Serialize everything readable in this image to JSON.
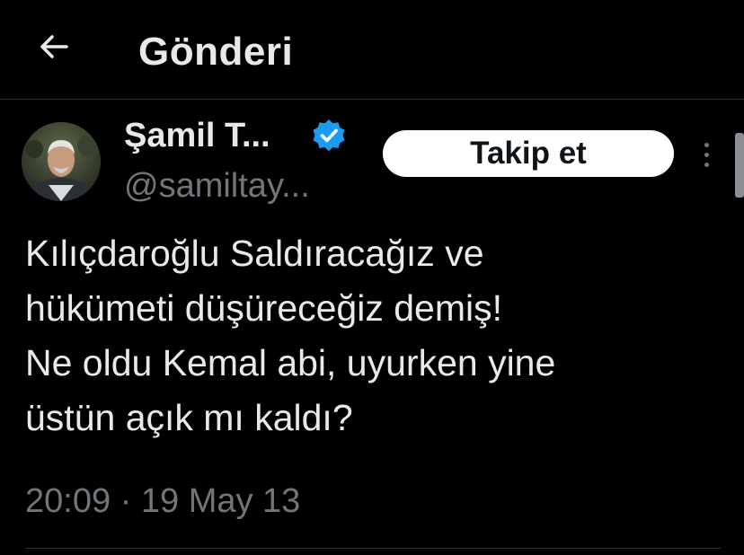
{
  "header": {
    "title": "Gönderi",
    "back_icon": "arrow-left-icon"
  },
  "post": {
    "author": {
      "display_name": "Şamil T...",
      "handle": "@samiltay...",
      "verified": true,
      "verified_color": "#1d9bf0",
      "avatar_icon": "user-avatar"
    },
    "follow_label": "Takip et",
    "more_icon": "more-vertical-icon",
    "text_lines": [
      "Kılıçdaroğlu Saldıracağız ve",
      "hükümeti düşüreceğiz demiş!",
      "Ne oldu Kemal abi, uyurken yine",
      "üstün açık mı kaldı?"
    ],
    "timestamp": "20:09 · 19 May 13"
  },
  "colors": {
    "background": "#000000",
    "text_primary": "#e7e9ea",
    "text_secondary": "#71767b",
    "divider": "#2f3336",
    "button_bg": "#ffffff",
    "button_text": "#0f1419"
  }
}
